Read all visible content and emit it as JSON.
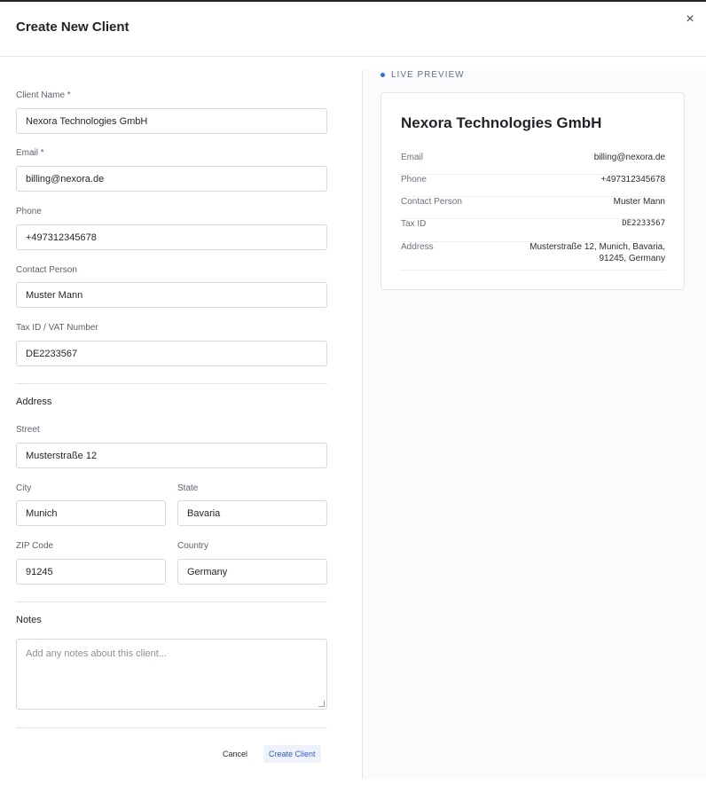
{
  "modal": {
    "title": "Create New Client",
    "close_glyph": "×"
  },
  "form": {
    "client_name": {
      "label": "Client Name *",
      "value": "Nexora Technologies GmbH"
    },
    "email": {
      "label": "Email *",
      "value": "billing@nexora.de"
    },
    "phone": {
      "label": "Phone",
      "value": "+497312345678"
    },
    "contact_person": {
      "label": "Contact Person",
      "value": "Muster Mann"
    },
    "tax_id": {
      "label": "Tax ID / VAT Number",
      "value": "DE2233567"
    },
    "address_section": "Address",
    "street": {
      "label": "Street",
      "value": "Musterstraße 12"
    },
    "city": {
      "label": "City",
      "value": "Munich"
    },
    "state": {
      "label": "State",
      "value": "Bavaria"
    },
    "zip": {
      "label": "ZIP Code",
      "value": "91245"
    },
    "country": {
      "label": "Country",
      "value": "Germany"
    },
    "notes_section": "Notes",
    "notes": {
      "placeholder": "Add any notes about this client...",
      "value": ""
    },
    "cancel_label": "Cancel",
    "create_label": "Create Client"
  },
  "preview": {
    "label": "LIVE PREVIEW",
    "name": "Nexora Technologies GmbH",
    "rows": [
      {
        "key": "Email",
        "value": "billing@nexora.de"
      },
      {
        "key": "Phone",
        "value": "+497312345678"
      },
      {
        "key": "Contact Person",
        "value": "Muster Mann"
      },
      {
        "key": "Tax ID",
        "value": "DE2233567"
      },
      {
        "key": "Address",
        "value_line1": "Musterstraße 12, Munich, Bavaria,",
        "value_line2": "91245, Germany"
      }
    ]
  },
  "colors": {
    "accent": "#2b6fe6",
    "primary_button_text": "#2b5fd9"
  },
  "icons": {
    "close": "close-icon",
    "live_dot": "status-dot-icon",
    "resize": "resize-grip-icon"
  }
}
